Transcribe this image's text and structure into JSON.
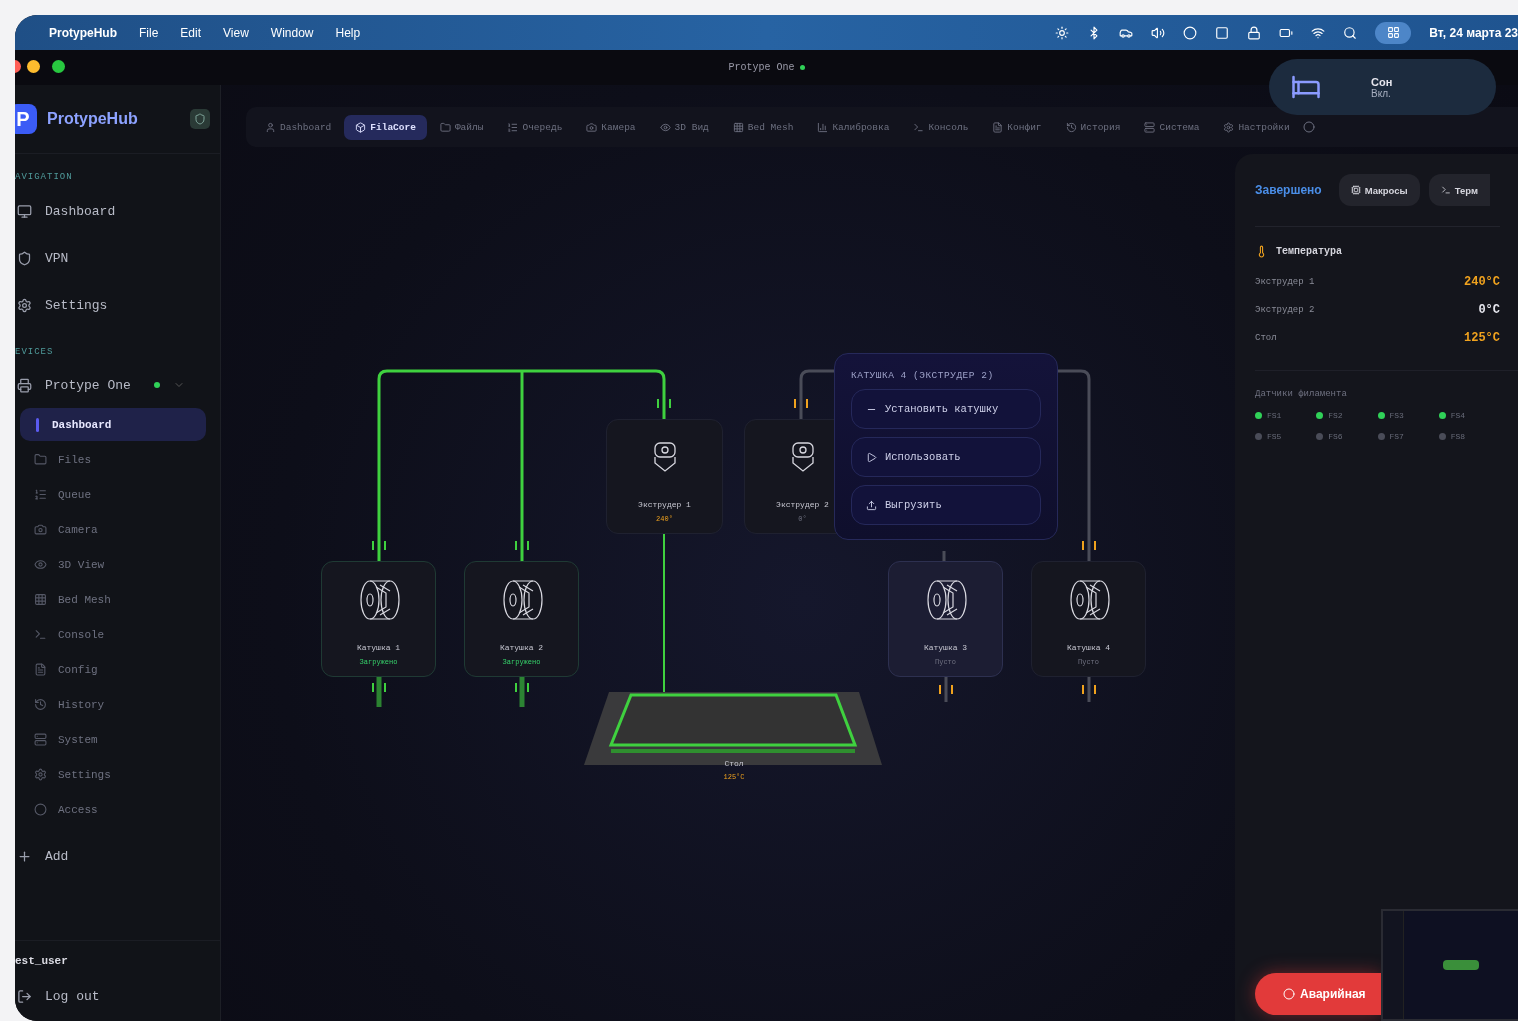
{
  "menubar": {
    "app": "ProtypeHub",
    "menus": [
      "File",
      "Edit",
      "View",
      "Window",
      "Help"
    ],
    "clock": "Вт, 24 марта 23"
  },
  "window": {
    "title": "Protype One",
    "online": true
  },
  "sleep_card": {
    "title": "Сон",
    "status": "Вкл."
  },
  "sidebar": {
    "logo_letter": "P",
    "brand": "ProtypeHub",
    "nav_heading": "AVIGATION",
    "nav_items": [
      {
        "label": "Dashboard"
      },
      {
        "label": "VPN"
      },
      {
        "label": "Settings"
      }
    ],
    "devices_heading": "EVICES",
    "device": {
      "name": "Protype One",
      "online": true,
      "expanded": true,
      "children": [
        {
          "label": "Dashboard",
          "selected": true
        },
        {
          "label": "Files",
          "selected": false
        },
        {
          "label": "Queue",
          "selected": false
        },
        {
          "label": "Camera",
          "selected": false
        },
        {
          "label": "3D View",
          "selected": false
        },
        {
          "label": "Bed Mesh",
          "selected": false
        },
        {
          "label": "Console",
          "selected": false
        },
        {
          "label": "Config",
          "selected": false
        },
        {
          "label": "History",
          "selected": false
        },
        {
          "label": "System",
          "selected": false
        },
        {
          "label": "Settings",
          "selected": false
        },
        {
          "label": "Access",
          "selected": false
        }
      ]
    },
    "add": "Add",
    "user": "est_user",
    "logout": "Log out"
  },
  "tabs": [
    {
      "label": "Dashboard",
      "selected": false
    },
    {
      "label": "FilaCore",
      "selected": true
    },
    {
      "label": "Файлы",
      "selected": false
    },
    {
      "label": "Очередь",
      "selected": false
    },
    {
      "label": "Камера",
      "selected": false
    },
    {
      "label": "3D Вид",
      "selected": false
    },
    {
      "label": "Bed Mesh",
      "selected": false
    },
    {
      "label": "Калибровка",
      "selected": false
    },
    {
      "label": "Консоль",
      "selected": false
    },
    {
      "label": "Конфиг",
      "selected": false
    },
    {
      "label": "История",
      "selected": false
    },
    {
      "label": "Система",
      "selected": false
    },
    {
      "label": "Настройки",
      "selected": false
    }
  ],
  "diagram": {
    "nodes": [
      {
        "kind": "spool",
        "label": "Катушка 1",
        "status": "Загружено",
        "loaded": true,
        "selected": false
      },
      {
        "kind": "spool",
        "label": "Катушка 2",
        "status": "Загружено",
        "loaded": true,
        "selected": false
      },
      {
        "kind": "extruder",
        "label": "Экструдер 1",
        "status": "240°",
        "hot": true,
        "selected": false
      },
      {
        "kind": "extruder",
        "label": "Экструдер 2",
        "status": "0°",
        "hot": false,
        "selected": false
      },
      {
        "kind": "spool",
        "label": "Катушка 3",
        "status": "Пусто",
        "loaded": false,
        "selected": true
      },
      {
        "kind": "spool",
        "label": "Катушка 4",
        "status": "Пусто",
        "loaded": false,
        "selected": false
      },
      {
        "kind": "bed",
        "label": "Стол",
        "status": "125°C",
        "hot": true
      }
    ],
    "popup": {
      "title": "КАТУШКА 4 (ЭКСТРУДЕР 2)",
      "actions": [
        "Установить катушку",
        "Использовать",
        "Выгрузить"
      ]
    }
  },
  "panel": {
    "status": "Завершено",
    "buttons": [
      "Макросы",
      "Терм"
    ],
    "temperature": {
      "title": "Температура",
      "rows": [
        {
          "label": "Экструдер 1",
          "value": "240°C",
          "hot": true
        },
        {
          "label": "Экструдер 2",
          "value": "0°C",
          "hot": false
        },
        {
          "label": "Стол",
          "value": "125°C",
          "hot": true
        }
      ]
    },
    "sensors": {
      "title": "Датчики филамента",
      "items": [
        {
          "label": "FS1",
          "active": true
        },
        {
          "label": "FS2",
          "active": true
        },
        {
          "label": "FS3",
          "active": true
        },
        {
          "label": "FS4",
          "active": true
        },
        {
          "label": "FS5",
          "active": false
        },
        {
          "label": "FS6",
          "active": false
        },
        {
          "label": "FS7",
          "active": false
        },
        {
          "label": "FS8",
          "active": false
        }
      ]
    },
    "emergency": "Аварийная"
  }
}
